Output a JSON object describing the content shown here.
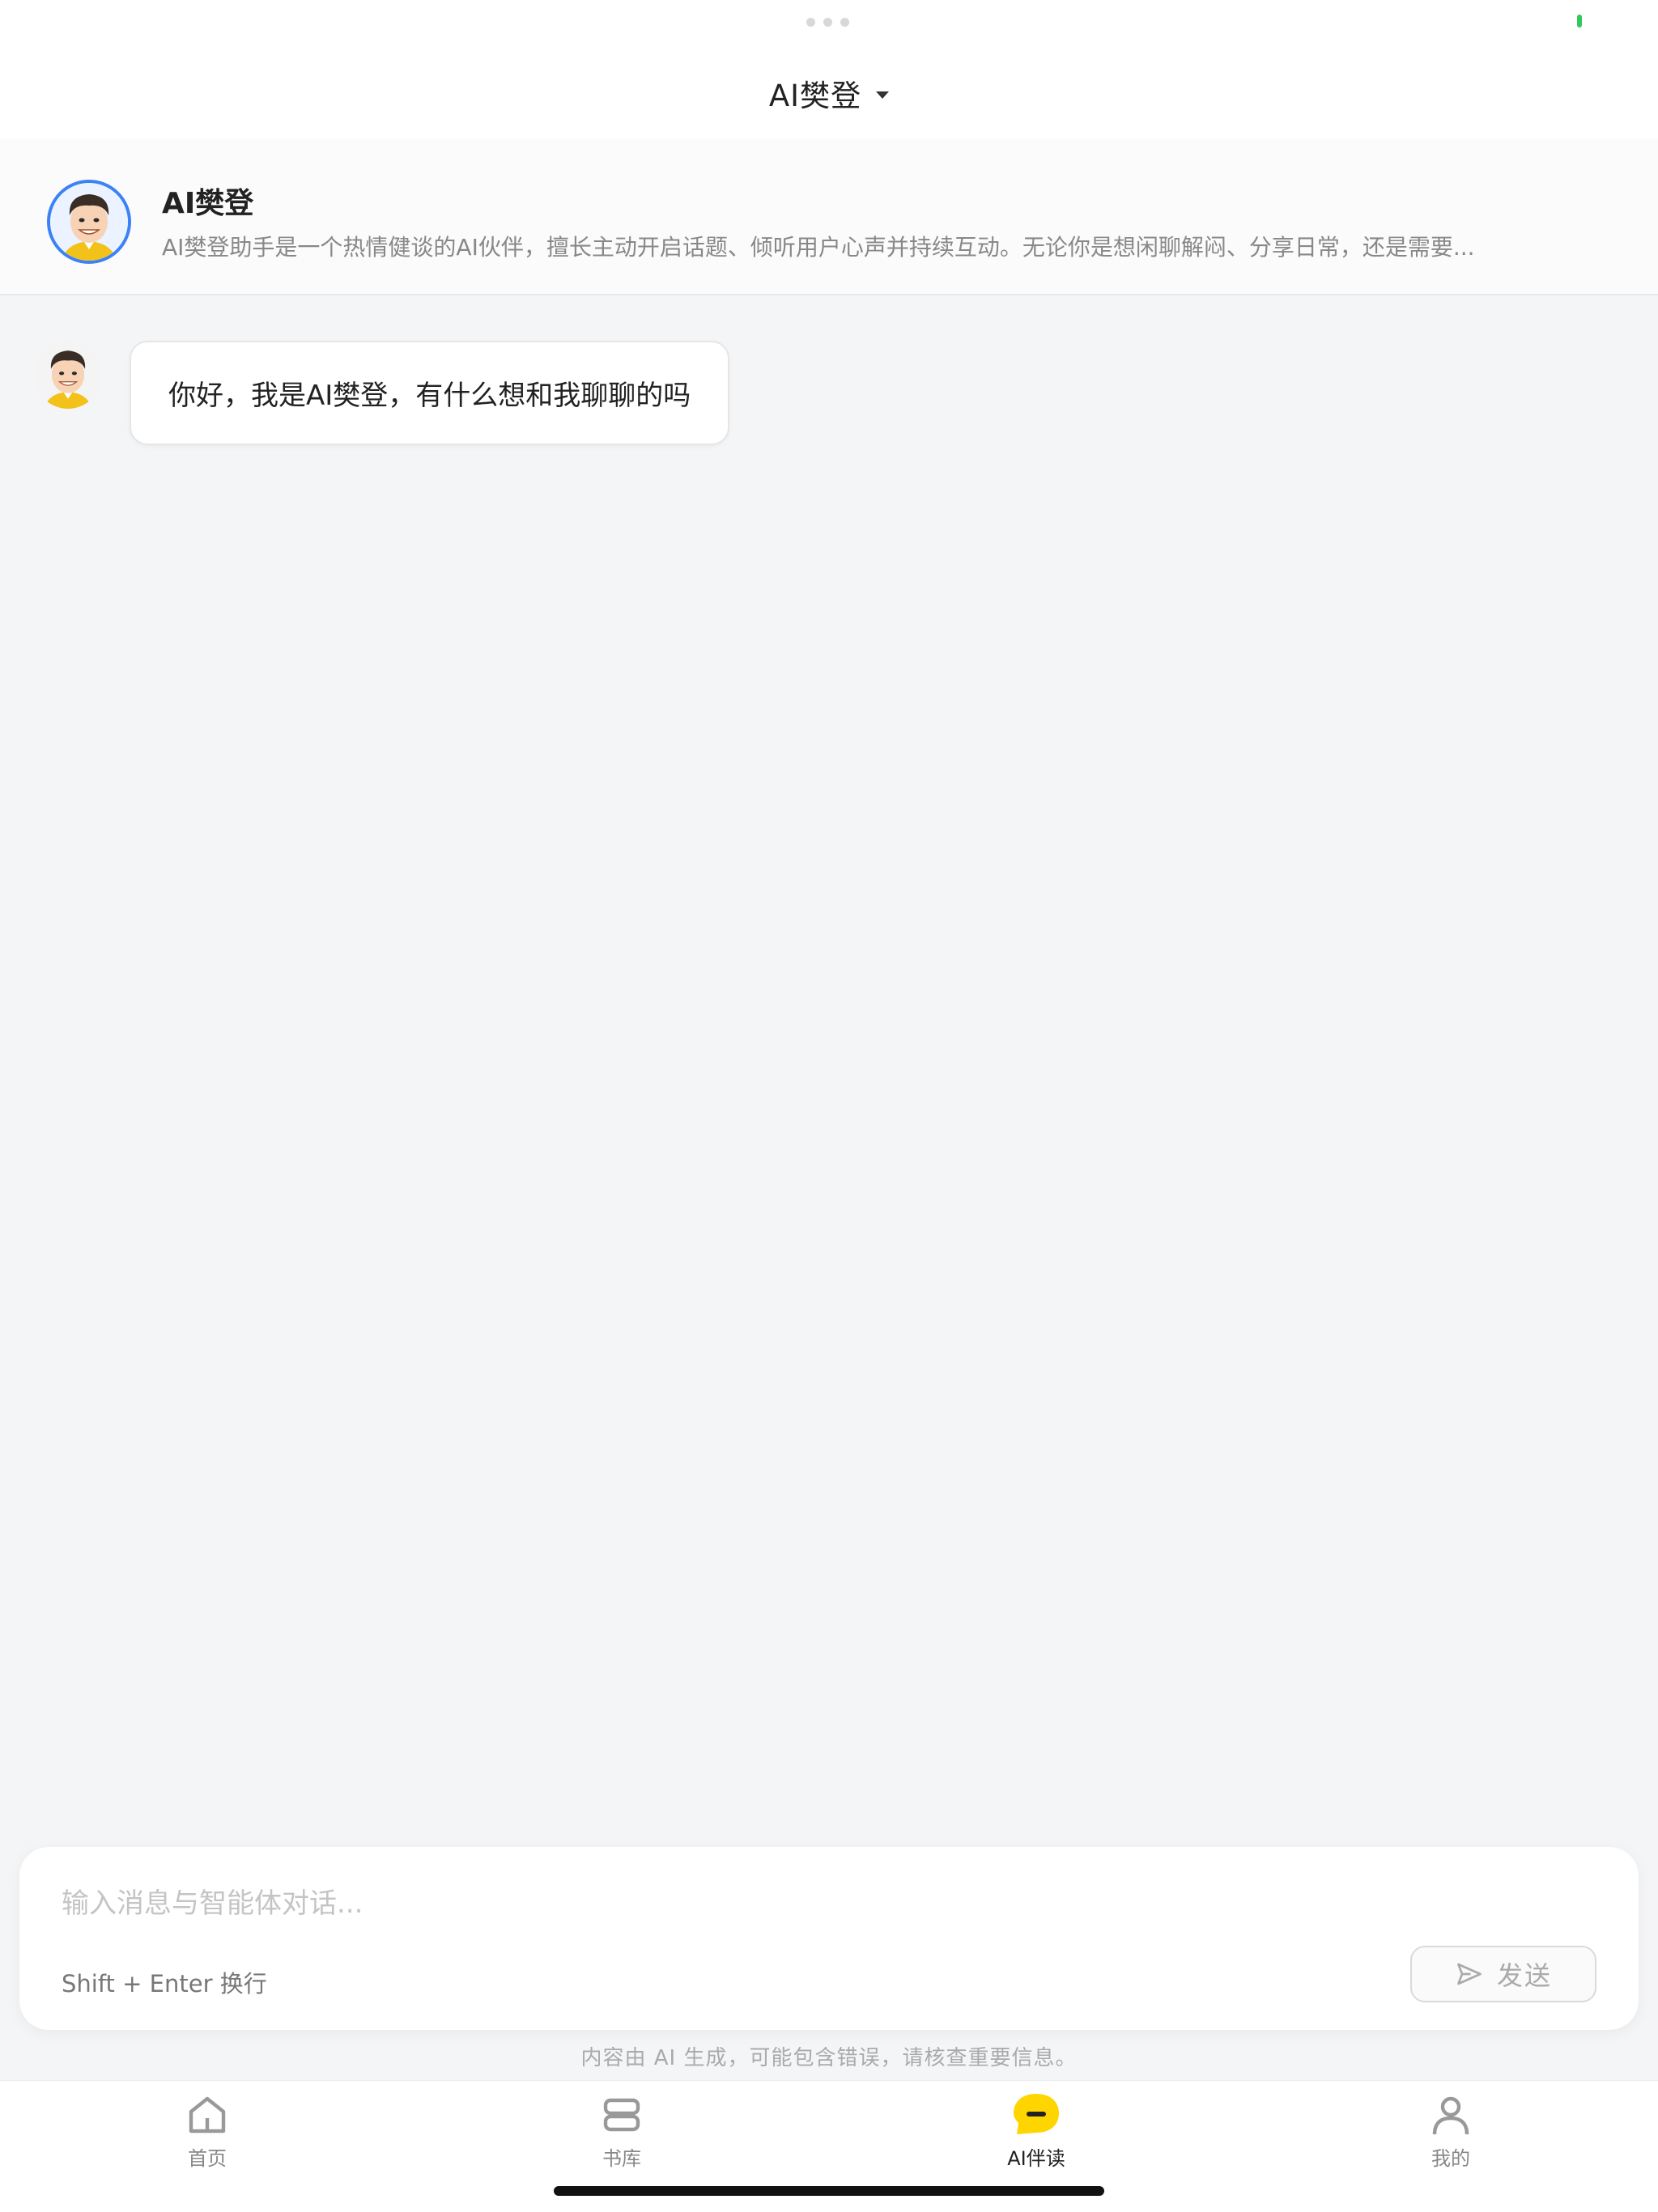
{
  "header": {
    "title": "AI樊登",
    "title_dropdown_icon": "caret-down-icon"
  },
  "agent": {
    "name": "AI樊登",
    "description": "AI樊登助手是一个热情健谈的AI伙伴，擅长主动开启话题、倾听用户心声并持续互动。无论你是想闲聊解闷、分享日常，还是需要...",
    "avatar_icon": "cartoon-avatar-icon",
    "avatar_ring_color": "#3b82f6"
  },
  "messages": [
    {
      "role": "assistant",
      "text": "你好，我是AI樊登，有什么想和我聊聊的吗"
    }
  ],
  "composer": {
    "placeholder": "输入消息与智能体对话...",
    "value": "",
    "hint": "Shift + Enter 换行",
    "send_label": "发送",
    "send_icon": "send-icon"
  },
  "disclaimer": "内容由 AI 生成，可能包含错误，请核查重要信息。",
  "tabs": [
    {
      "label": "首页",
      "icon": "home-icon",
      "active": false
    },
    {
      "label": "书库",
      "icon": "library-icon",
      "active": false
    },
    {
      "label": "AI伴读",
      "icon": "chat-bubble-icon",
      "active": true
    },
    {
      "label": "我的",
      "icon": "profile-icon",
      "active": false
    }
  ],
  "colors": {
    "accent": "#ffd500",
    "battery": "#34c759",
    "background": "#f4f5f7"
  }
}
